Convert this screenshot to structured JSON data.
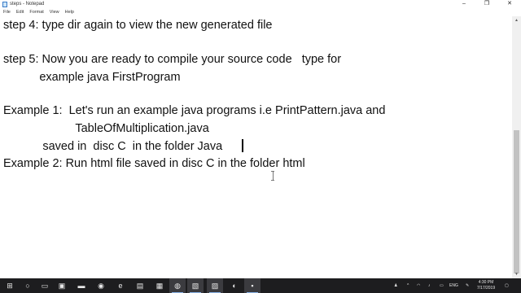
{
  "window": {
    "title": "steps - Notepad",
    "controls": {
      "minimize": "–",
      "maximize": "❐",
      "close": "✕"
    }
  },
  "menu": [
    "File",
    "Edit",
    "Format",
    "View",
    "Help"
  ],
  "editor": {
    "lines": [
      "step 4: type dir again to view the new generated file",
      "",
      "step 5: Now you are ready to compile your source code   type for",
      "           example java FirstProgram",
      "",
      "Example 1:  Let's run an example java programs i.e PrintPattern.java and",
      "                      TableOfMultiplication.java",
      "            saved in  disc C  in the folder Java",
      "Example 2: Run html file saved in disc C in the folder html"
    ]
  },
  "taskbar": {
    "icons": [
      {
        "name": "windows-start-icon",
        "glyph": "⊞"
      },
      {
        "name": "search-icon",
        "glyph": "○"
      },
      {
        "name": "task-view-icon",
        "glyph": "▭"
      },
      {
        "name": "media-player-icon",
        "glyph": "▣"
      },
      {
        "name": "file-explorer-icon",
        "glyph": "▬"
      },
      {
        "name": "settings-icon",
        "glyph": "◉"
      },
      {
        "name": "edge-browser-icon",
        "glyph": "e"
      },
      {
        "name": "store-icon",
        "glyph": "▤"
      },
      {
        "name": "photos-icon",
        "glyph": "▦"
      },
      {
        "name": "chrome-icon",
        "glyph": "◍"
      },
      {
        "name": "app-icon",
        "glyph": "▧"
      },
      {
        "name": "notepad-icon",
        "glyph": "▨"
      },
      {
        "name": "java-icon",
        "glyph": "◐"
      },
      {
        "name": "terminal-icon",
        "glyph": "▪"
      }
    ],
    "tray": {
      "up_chevron": "^",
      "language": "ENG",
      "time": "4:30 PM",
      "date": "7/17/2019"
    }
  },
  "colors": {
    "taskbar": "#1d1d1f",
    "text": "#111111",
    "accent": "#8ab4e8"
  }
}
